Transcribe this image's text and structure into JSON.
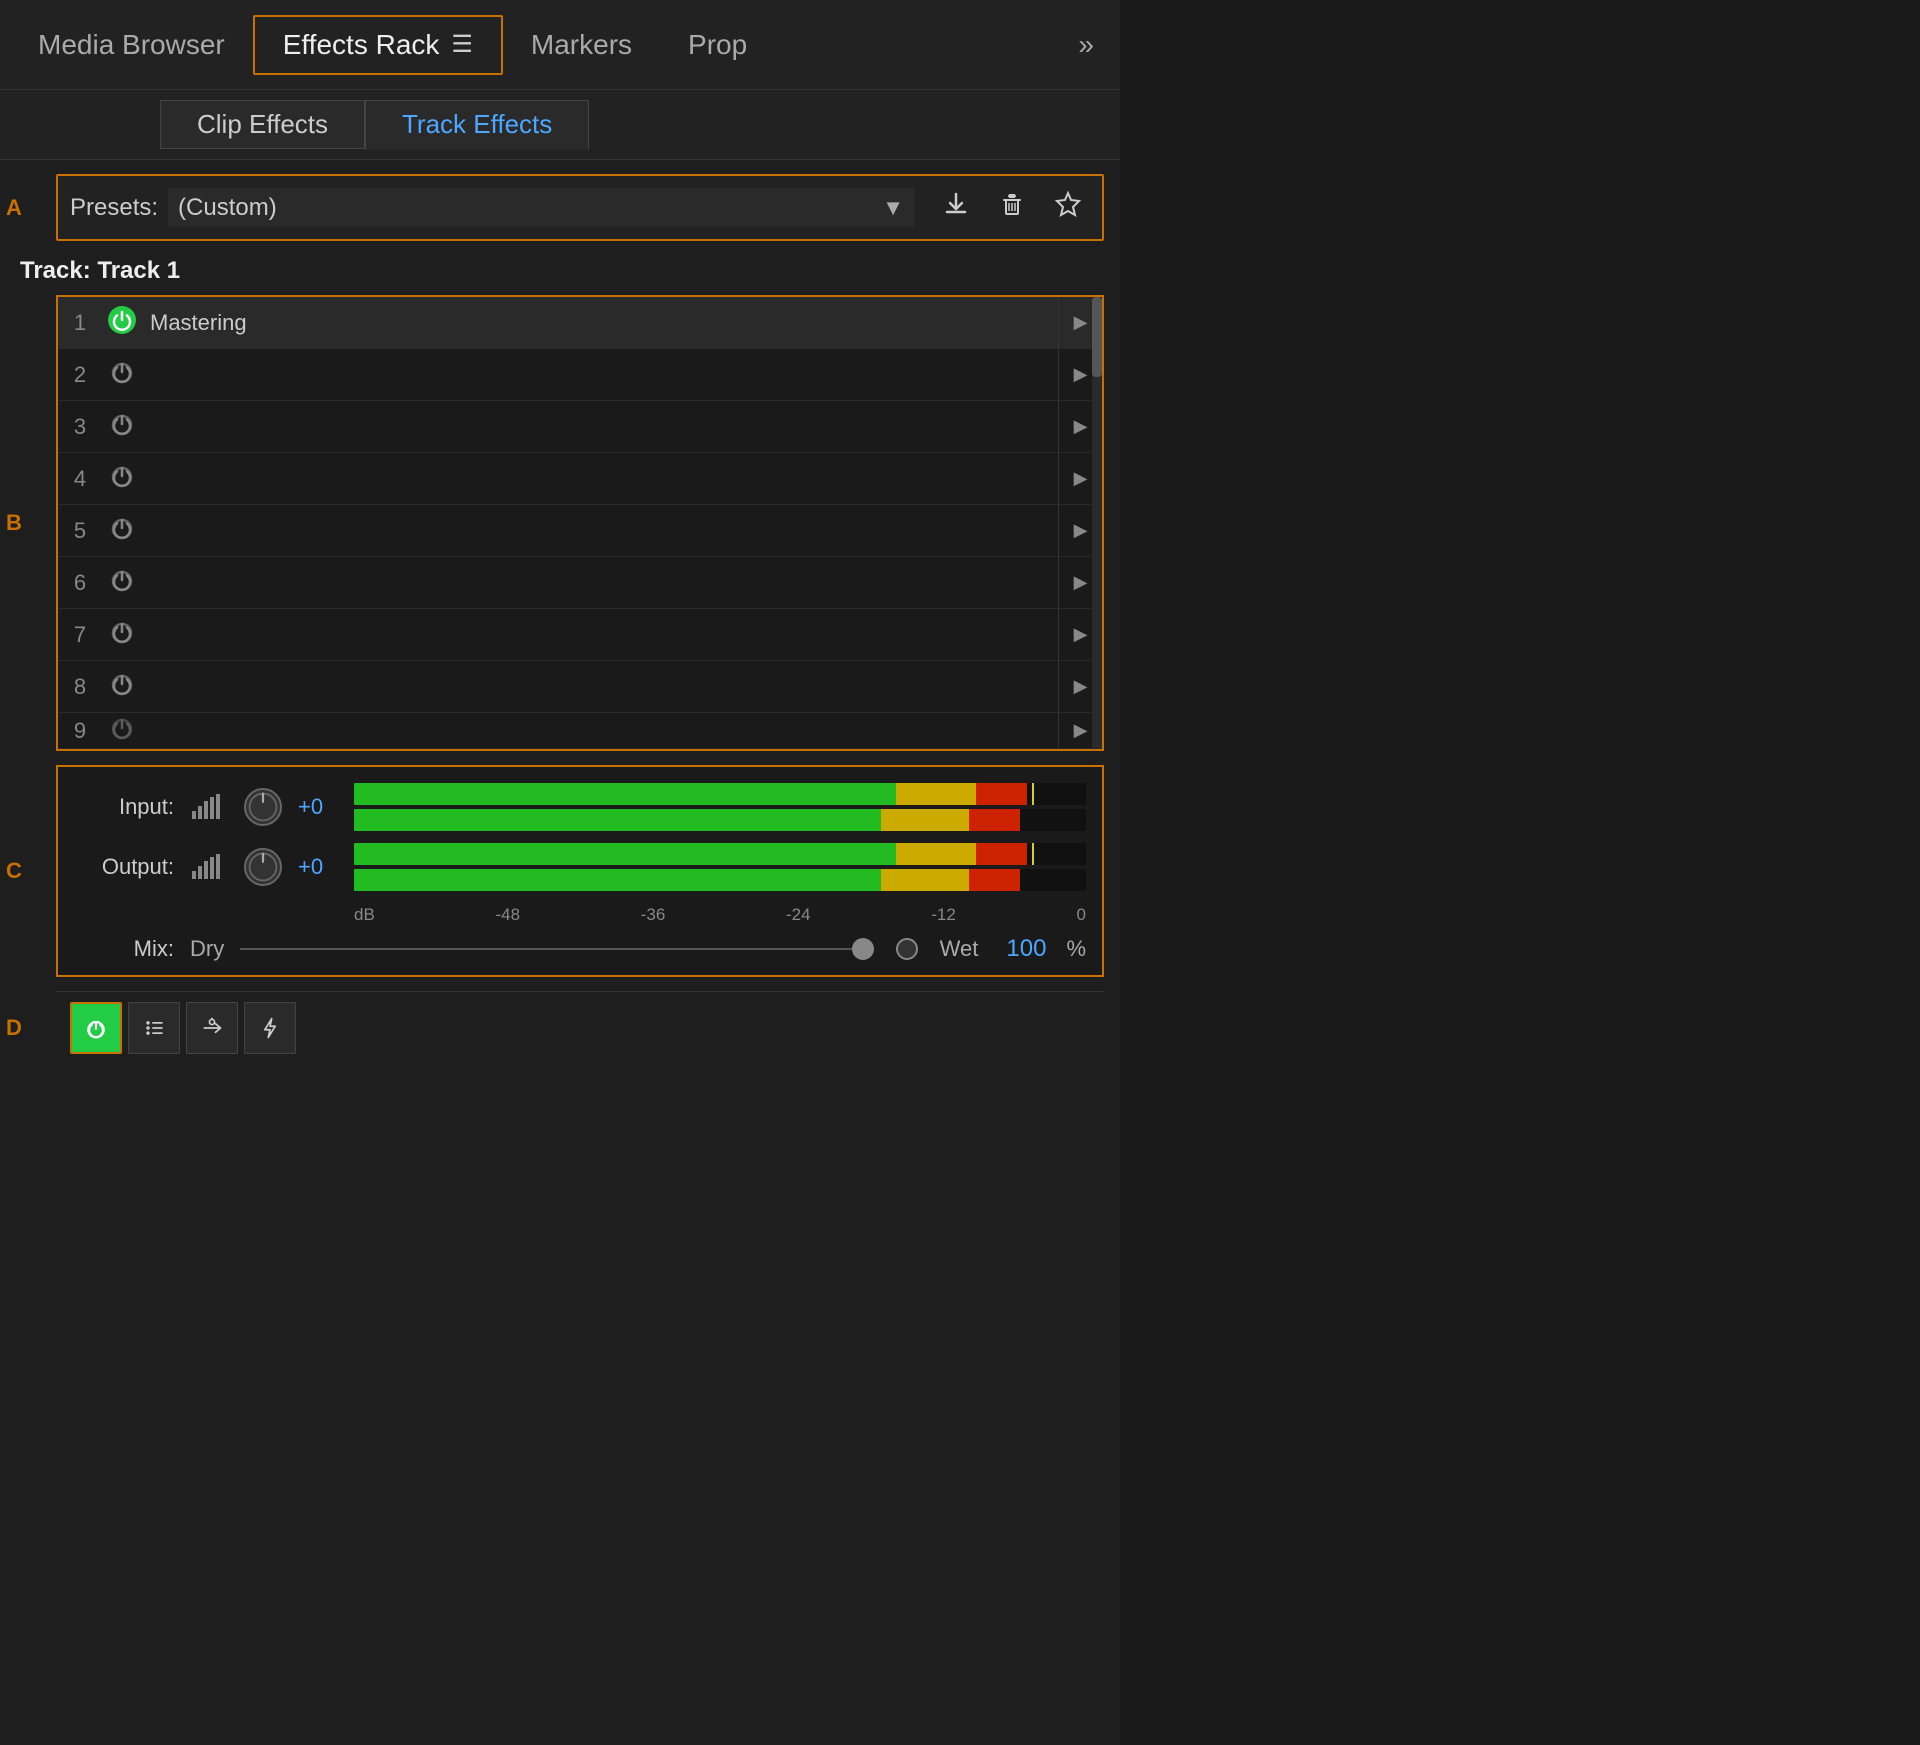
{
  "tabs": {
    "items": [
      {
        "label": "Media Browser",
        "active": false
      },
      {
        "label": "Effects Rack",
        "active": true
      },
      {
        "label": "Markers",
        "active": false
      },
      {
        "label": "Prop",
        "active": false
      }
    ],
    "more_label": "»"
  },
  "sub_tabs": {
    "items": [
      {
        "label": "Clip Effects",
        "active": false
      },
      {
        "label": "Track Effects",
        "active": true
      }
    ]
  },
  "labels": {
    "a": "A",
    "b": "B",
    "c": "C",
    "d": "D"
  },
  "presets": {
    "label": "Presets:",
    "value": "(Custom)",
    "placeholder": "(Custom)",
    "download_title": "Download preset",
    "delete_title": "Delete preset",
    "star_title": "Save preset"
  },
  "track": {
    "label": "Track: Track 1"
  },
  "effects": [
    {
      "num": 1,
      "name": "Mastering",
      "power_on": true,
      "active": true
    },
    {
      "num": 2,
      "name": "",
      "power_on": false,
      "active": false
    },
    {
      "num": 3,
      "name": "",
      "power_on": false,
      "active": false
    },
    {
      "num": 4,
      "name": "",
      "power_on": false,
      "active": false
    },
    {
      "num": 5,
      "name": "",
      "power_on": false,
      "active": false
    },
    {
      "num": 6,
      "name": "",
      "power_on": false,
      "active": false
    },
    {
      "num": 7,
      "name": "",
      "power_on": false,
      "active": false
    },
    {
      "num": 8,
      "name": "",
      "power_on": false,
      "active": false
    },
    {
      "num": 9,
      "name": "",
      "power_on": false,
      "active": false,
      "partial": true
    }
  ],
  "io": {
    "input_label": "Input:",
    "input_value": "+0",
    "output_label": "Output:",
    "output_value": "+0",
    "meter_input": {
      "green_pct": 74,
      "yellow_pct": 11,
      "red_pct": 6
    },
    "meter_output": {
      "green_pct": 74,
      "yellow_pct": 11,
      "red_pct": 6
    },
    "scale_labels": [
      "dB",
      "-48",
      "-36",
      "-24",
      "-12",
      "0"
    ]
  },
  "mix": {
    "label": "Mix:",
    "dry_label": "Dry",
    "wet_label": "Wet",
    "value": 100,
    "unit": "%"
  },
  "toolbar": {
    "power_title": "Enable/Disable",
    "list_title": "Show effect list",
    "insert_title": "Insert effect",
    "lightning_title": "Auto-match"
  },
  "colors": {
    "orange": "#c87000",
    "blue": "#4da6ff",
    "green": "#22cc44",
    "red": "#cc2200",
    "yellow_meter": "#ccaa00"
  }
}
